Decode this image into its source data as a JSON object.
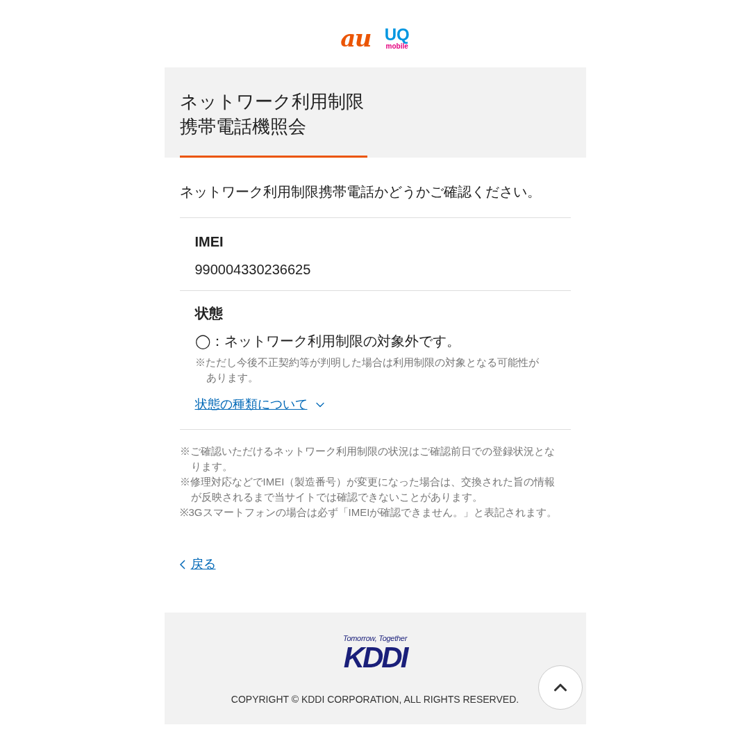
{
  "brand_logos": {
    "au": "au",
    "uq": "UQ",
    "uq_sub": "mobile"
  },
  "header": {
    "title_lines": [
      "ネットワーク利用制限",
      "携帯電話機照会"
    ]
  },
  "intro": "ネットワーク利用制限携帯電話かどうかご確認ください。",
  "imei": {
    "label": "IMEI",
    "value": "990004330236625"
  },
  "status": {
    "label": "状態",
    "symbol": "◯",
    "separator": "：",
    "text": "ネットワーク利用制限の対象外です。",
    "caution": "※ただし今後不正契約等が判明した場合は利用制限の対象となる可能性があります。",
    "link": {
      "label": "状態の種類について",
      "expanded": false
    }
  },
  "notes": [
    "※ご確認いただけるネットワーク利用制限の状況はご確認前日での登録状況となります。",
    "※修理対応などでIMEI（製造番号）が変更になった場合は、交換された旨の情報が反映されるまで当サイトでは確認できないことがあります。",
    "※3Gスマートフォンの場合は必ず「IMEIが確認できません。」と表記されます。"
  ],
  "back_link": "戻る",
  "footer": {
    "tagline": "Tomorrow, Together",
    "logo": "KDDI",
    "copyright": "COPYRIGHT © KDDI CORPORATION, ALL RIGHTS RESERVED."
  }
}
